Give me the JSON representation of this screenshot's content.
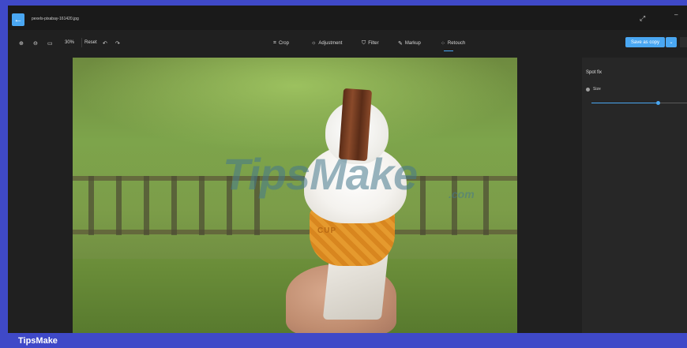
{
  "window": {
    "filename": "pexels-pixabay-161420.jpg",
    "back_icon": "back-arrow-icon",
    "expand_icon": "expand-icon",
    "minimize_icon": "minimize-icon"
  },
  "toolbar": {
    "zoom_in_icon": "zoom-in-icon",
    "zoom_out_icon": "zoom-out-icon",
    "fit_icon": "fit-to-screen-icon",
    "zoom_level": "30%",
    "reset_label": "Reset",
    "undo_icon": "undo-icon",
    "redo_icon": "redo-icon",
    "tools": [
      {
        "label": "Crop",
        "icon": "crop-icon",
        "glyph": "⌗"
      },
      {
        "label": "Adjustment",
        "icon": "adjustment-icon",
        "glyph": "☼"
      },
      {
        "label": "Filter",
        "icon": "filter-icon",
        "glyph": "⛉"
      },
      {
        "label": "Markup",
        "icon": "markup-icon",
        "glyph": "✎"
      },
      {
        "label": "Retouch",
        "icon": "retouch-icon",
        "glyph": "⁘"
      }
    ],
    "active_tool": "Retouch",
    "save_label": "Save as copy",
    "save_dropdown_icon": "chevron-down-icon"
  },
  "image": {
    "watermark": "TipsMake",
    "watermark_suffix": ".com",
    "cone_text": "CUP"
  },
  "panel": {
    "title": "Spot fix",
    "size_label": "Size",
    "size_value_fraction": 0.7
  },
  "footer": {
    "brand": "TipsMake"
  },
  "colors": {
    "accent": "#4aa7f2",
    "frame": "#3f49c8",
    "app_bg": "#202020"
  }
}
